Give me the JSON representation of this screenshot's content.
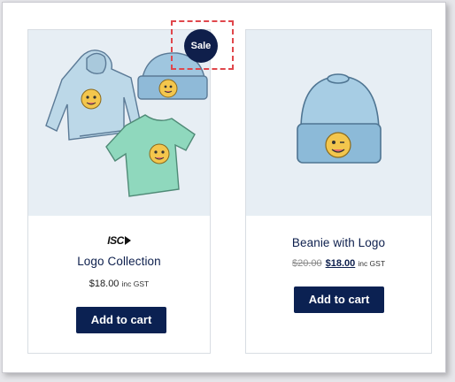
{
  "products": [
    {
      "brand_logo": "ISC",
      "title": "Logo Collection",
      "price": "$18.00",
      "tax_note": "inc GST",
      "button_label": "Add to cart",
      "badge": "Sale",
      "image": "hoodie-tshirt-beanie-illustration"
    },
    {
      "title": "Beanie with Logo",
      "old_price": "$20.00",
      "price": "$18.00",
      "tax_note": "inc GST",
      "button_label": "Add to cart",
      "image": "beanie-illustration"
    }
  ],
  "colors": {
    "button": "#0b2152",
    "title": "#0d1f4d",
    "image_bg": "#e7eef4",
    "highlight": "#e0474c"
  }
}
